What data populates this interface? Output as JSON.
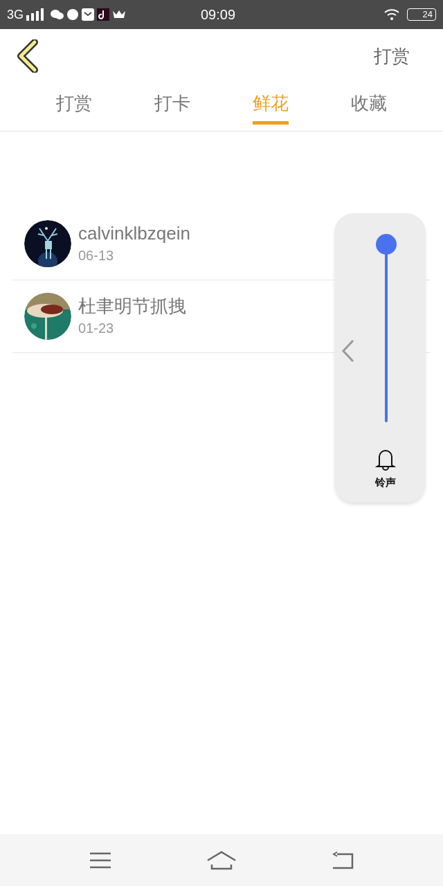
{
  "status_bar": {
    "network": "3G",
    "time": "09:09",
    "battery": "24"
  },
  "header": {
    "action": "打赏"
  },
  "tabs": [
    {
      "label": "打赏",
      "selected": false
    },
    {
      "label": "打卡",
      "selected": false
    },
    {
      "label": "鲜花",
      "selected": true
    },
    {
      "label": "收藏",
      "selected": false
    }
  ],
  "rows": [
    {
      "name": "calvinklbzqein",
      "date": "06-13"
    },
    {
      "name": "杜聿明节抓拽",
      "date": "01-23"
    }
  ],
  "volume_panel": {
    "level": 1,
    "label": "铃声"
  }
}
